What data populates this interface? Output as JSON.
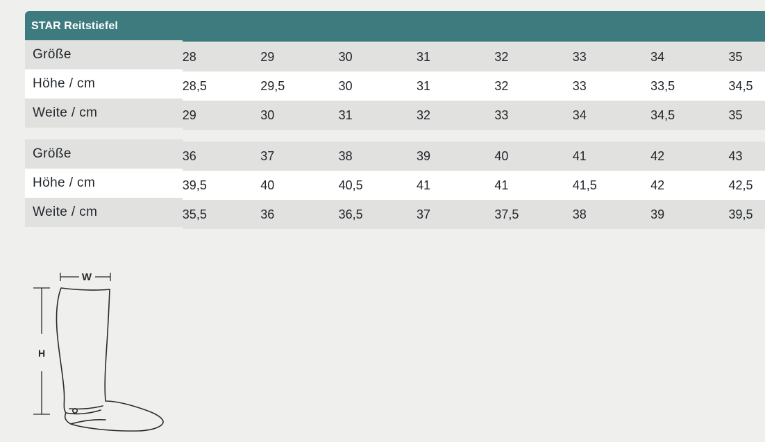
{
  "table": {
    "title": "STAR Reitstiefel",
    "groups": [
      {
        "rows": [
          {
            "label": "Größe",
            "values": [
              "28",
              "29",
              "30",
              "31",
              "32",
              "33",
              "34",
              "35"
            ]
          },
          {
            "label": "Höhe / cm",
            "values": [
              "28,5",
              "29,5",
              "30",
              "31",
              "32",
              "33",
              "33,5",
              "34,5"
            ]
          },
          {
            "label": "Weite / cm",
            "values": [
              "29",
              "30",
              "31",
              "32",
              "33",
              "34",
              "34,5",
              "35"
            ]
          }
        ]
      },
      {
        "rows": [
          {
            "label": "Größe",
            "values": [
              "36",
              "37",
              "38",
              "39",
              "40",
              "41",
              "42",
              "43"
            ]
          },
          {
            "label": "Höhe / cm",
            "values": [
              "39,5",
              "40",
              "40,5",
              "41",
              "41",
              "41,5",
              "42",
              "42,5"
            ]
          },
          {
            "label": "Weite / cm",
            "values": [
              "35,5",
              "36",
              "36,5",
              "37",
              "37,5",
              "38",
              "39",
              "39,5"
            ]
          }
        ]
      }
    ]
  },
  "diagram": {
    "width_label": "W",
    "height_label": "H"
  },
  "colors": {
    "header_bg": "#3d7b7e",
    "row_grey": "#e1e1df",
    "row_white": "#ffffff",
    "page_bg": "#efefed"
  }
}
